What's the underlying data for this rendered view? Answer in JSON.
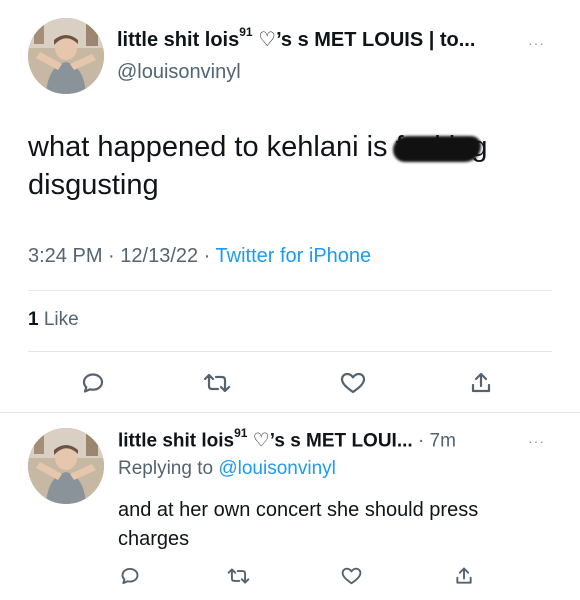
{
  "main_tweet": {
    "display_name": "little shit lois",
    "name_superscript": "91",
    "name_suffix": " ♡’s s MET LOUIS | to...",
    "handle": "@louisonvinyl",
    "text_before": "what happened to kehlani is ",
    "text_censored": "fucking",
    "text_after": " disgusting",
    "time": "3:24 PM",
    "date": "12/13/22",
    "separator": " · ",
    "source": "Twitter for iPhone",
    "likes_count": "1",
    "likes_label": " Like",
    "more_icon": "···"
  },
  "reply": {
    "display_name": "little shit lois",
    "name_superscript": "91",
    "name_suffix": " ♡’s s MET LOUI...",
    "time_ago": " · 7m",
    "replying_label": "Replying to ",
    "replying_mention": "@louisonvinyl",
    "text": "and at her own concert she should press charges",
    "more_icon": "···"
  },
  "icons": {
    "reply": "reply-icon",
    "retweet": "retweet-icon",
    "like": "like-icon",
    "share": "share-icon",
    "more": "more-icon"
  },
  "colors": {
    "text": "#0f1419",
    "secondary": "#536471",
    "link": "#1d9bf0",
    "divider": "#e1e6ea"
  }
}
